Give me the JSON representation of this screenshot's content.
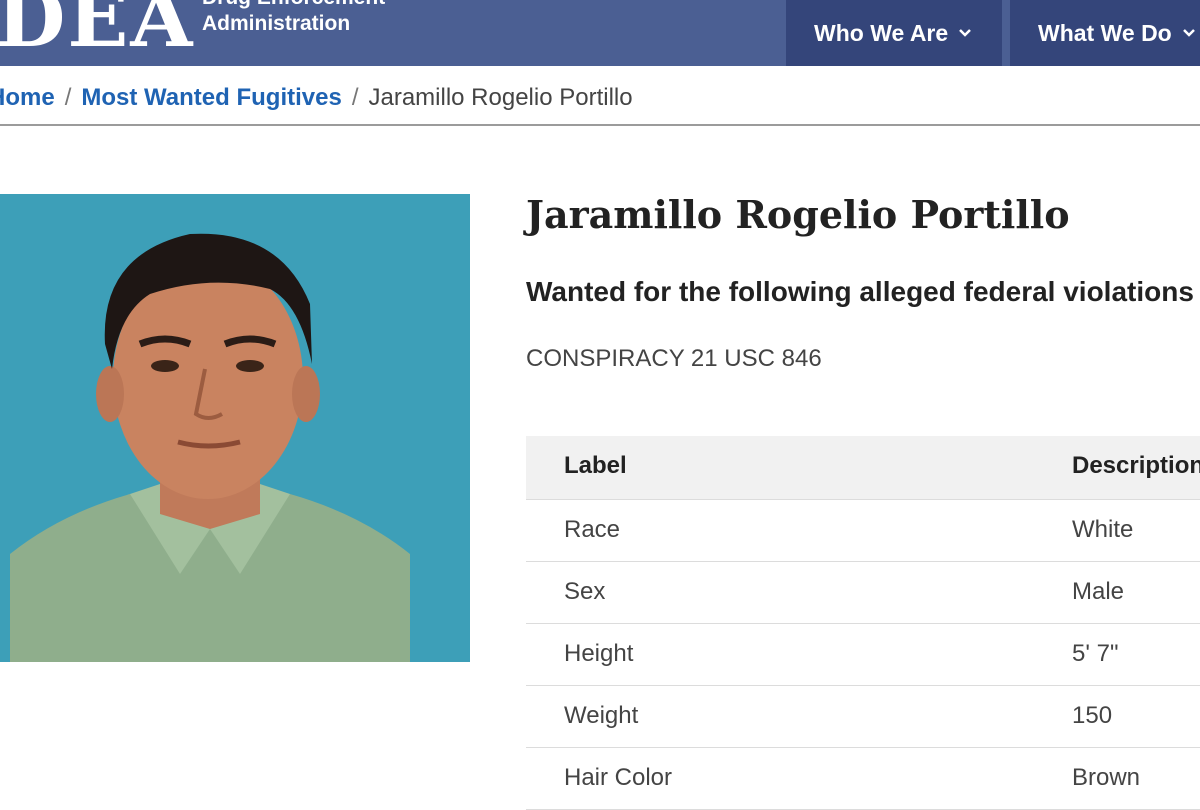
{
  "header": {
    "logo": "DEA",
    "agency_line1": "Drug Enforcement",
    "agency_line2": "Administration",
    "nav": [
      {
        "label": "Who We Are"
      },
      {
        "label": "What We Do"
      }
    ]
  },
  "breadcrumb": {
    "home": "Home",
    "section": "Most Wanted Fugitives",
    "current": "Jaramillo Rogelio Portillo"
  },
  "profile": {
    "name": "Jaramillo Rogelio Portillo",
    "wanted_heading": "Wanted for the following alleged federal violations",
    "charge": "CONSPIRACY 21 USC 846"
  },
  "table": {
    "headers": [
      "Label",
      "Description"
    ],
    "rows": [
      [
        "Race",
        "White"
      ],
      [
        "Sex",
        "Male"
      ],
      [
        "Height",
        "5' 7\""
      ],
      [
        "Weight",
        "150"
      ],
      [
        "Hair Color",
        "Brown"
      ]
    ]
  },
  "colors": {
    "header_bg": "#4b5f93",
    "nav_bg": "#34457a",
    "link": "#1f63b3",
    "photo_bg": "#3a9ab4"
  }
}
